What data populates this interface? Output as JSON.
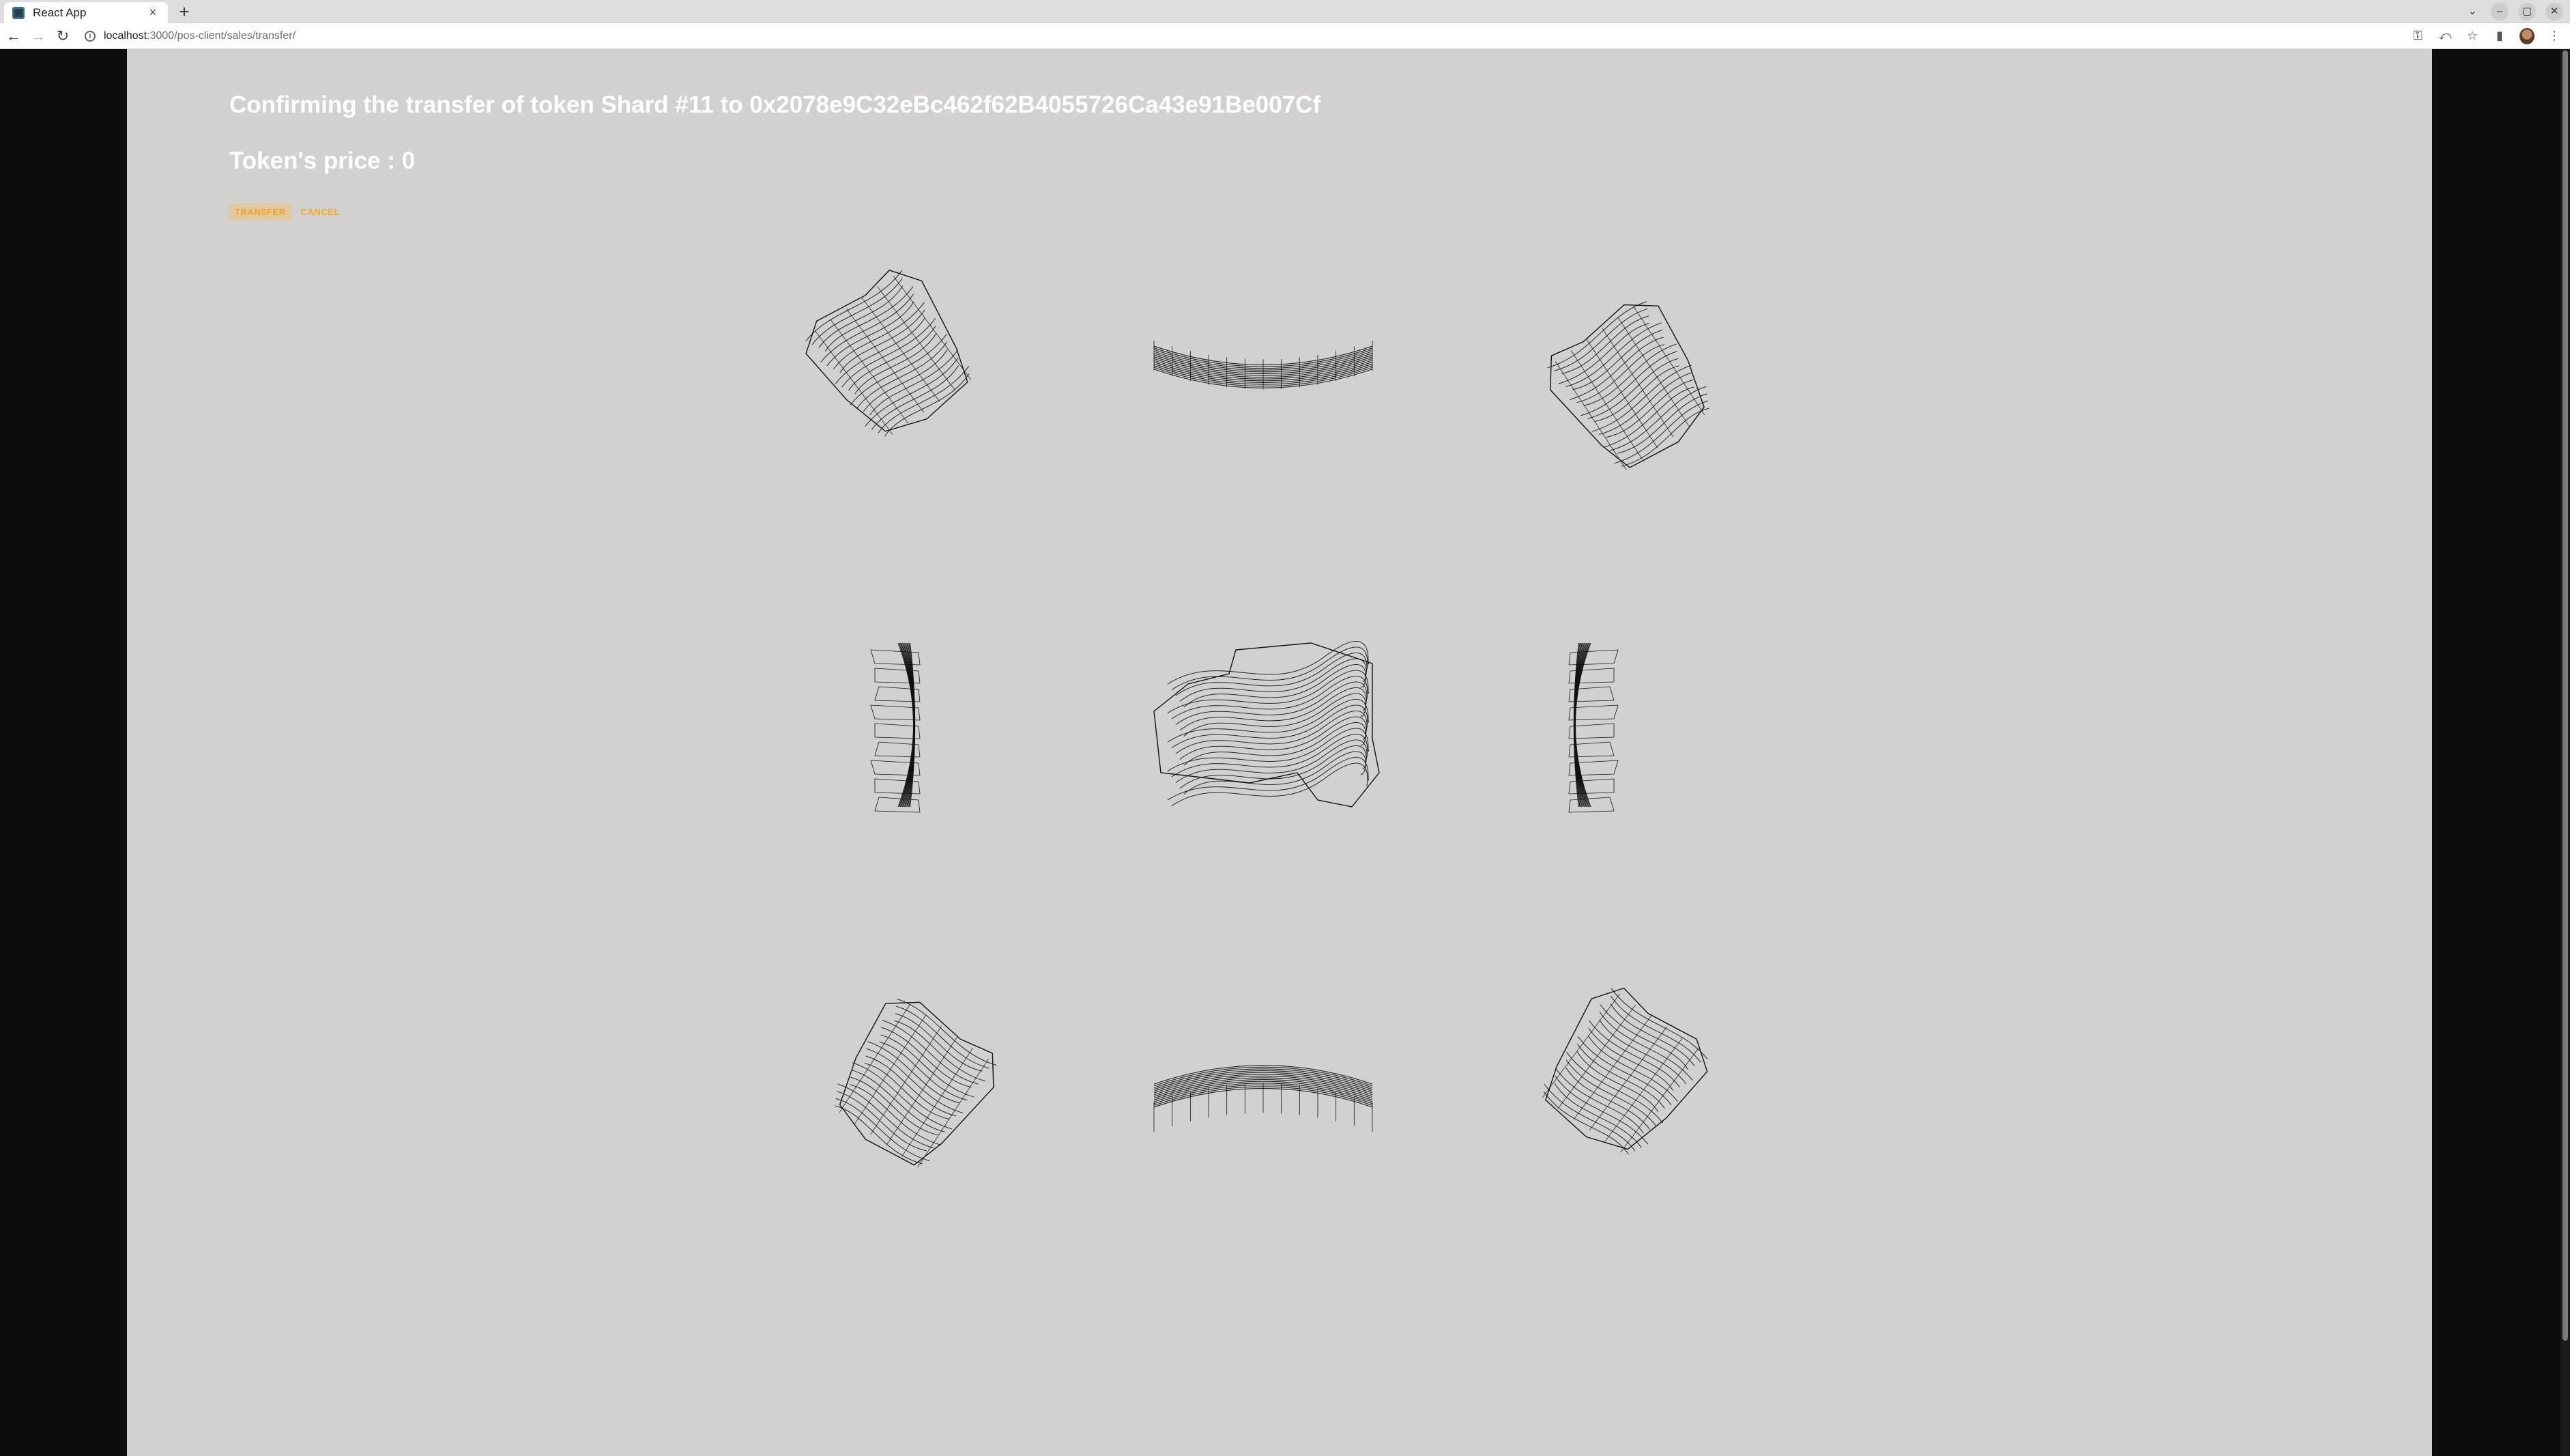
{
  "browser": {
    "tab_title": "React App",
    "tab_close": "×",
    "new_tab": "+",
    "url_host": "localhost",
    "url_path": ":3000/pos-client/sales/transfer/",
    "window_controls": [
      "⌄",
      "–",
      "▢",
      "✕"
    ]
  },
  "page": {
    "title": "Confirming the transfer of token Shard #11 to 0x2078e9C32eBc462f62B4055726Ca43e91Be007Cf",
    "price_line": "Token's price : 0",
    "transfer_label": "TRANSFER",
    "cancel_label": "CANCEL"
  },
  "shards": [
    {
      "name": "shard-view-top-left",
      "icon": "wireframe-shard"
    },
    {
      "name": "shard-view-top-center",
      "icon": "wireframe-arc"
    },
    {
      "name": "shard-view-top-right",
      "icon": "wireframe-shard"
    },
    {
      "name": "shard-view-middle-left",
      "icon": "wireframe-side"
    },
    {
      "name": "shard-view-center",
      "icon": "wireframe-top"
    },
    {
      "name": "shard-view-middle-right",
      "icon": "wireframe-side"
    },
    {
      "name": "shard-view-bottom-left",
      "icon": "wireframe-shard"
    },
    {
      "name": "shard-view-bottom-center",
      "icon": "wireframe-arc"
    },
    {
      "name": "shard-view-bottom-right",
      "icon": "wireframe-shard"
    }
  ],
  "colors": {
    "background": "#d5d0d0",
    "title": "#ffffff",
    "button": "#f5a623",
    "wireframe": "#111111"
  }
}
